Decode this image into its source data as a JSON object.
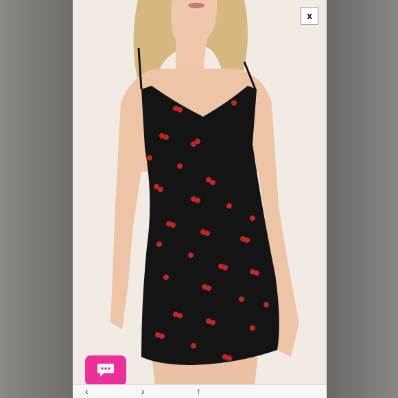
{
  "overlay": {
    "close_label": "x"
  },
  "chat": {
    "icon": "chat-bubble-icon",
    "color": "#ec2f9b"
  },
  "bottom_bar": {
    "icons": [
      "back-arrow-icon",
      "forward-arrow-icon",
      "share-icon"
    ]
  },
  "colors": {
    "background": "#f1ebe4",
    "dress": "#141414",
    "cherry": "#c2281f"
  }
}
